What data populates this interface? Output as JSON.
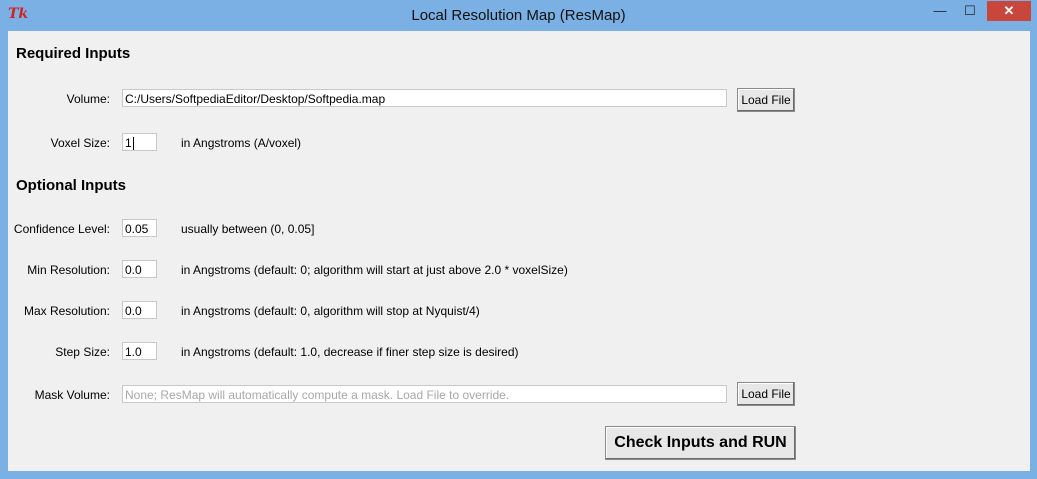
{
  "window": {
    "title": "Local Resolution Map (ResMap)",
    "icon_text": "Tk",
    "controls": {
      "minimize": "—",
      "maximize": "☐",
      "close": "✕"
    }
  },
  "required": {
    "heading": "Required Inputs",
    "volume": {
      "label": "Volume:",
      "value": "C:/Users/SoftpediaEditor/Desktop/Softpedia.map",
      "button": "Load File"
    },
    "voxel": {
      "label": "Voxel Size:",
      "value": "1",
      "hint": "in Angstroms (A/voxel)"
    }
  },
  "optional": {
    "heading": "Optional Inputs",
    "confidence": {
      "label": "Confidence Level:",
      "value": "0.05",
      "hint": "usually between (0, 0.05]"
    },
    "min_res": {
      "label": "Min Resolution:",
      "value": "0.0",
      "hint": "in Angstroms (default: 0; algorithm will start at just above 2.0 * voxelSize)"
    },
    "max_res": {
      "label": "Max Resolution:",
      "value": "0.0",
      "hint": "in Angstroms (default: 0, algorithm will stop at Nyquist/4)"
    },
    "step": {
      "label": "Step Size:",
      "value": "1.0",
      "hint": "in Angstroms (default: 1.0, decrease if finer step size is desired)"
    },
    "mask": {
      "label": "Mask Volume:",
      "placeholder": "None; ResMap will automatically compute a mask. Load File to override.",
      "button": "Load File"
    }
  },
  "run_button": "Check Inputs and RUN"
}
